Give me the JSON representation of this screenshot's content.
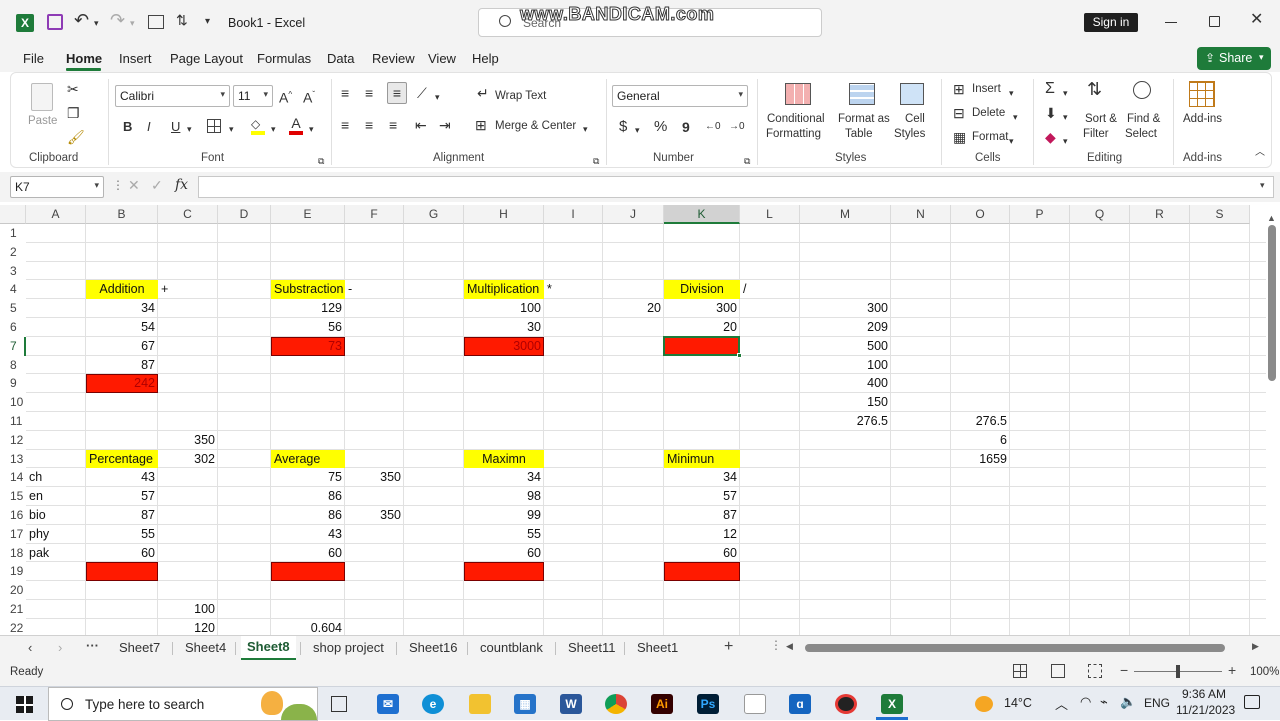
{
  "titlebar": {
    "title": "Book1  -  Excel",
    "search_placeholder": "Search",
    "watermark": "www.BANDICAM.com",
    "sign_in": "Sign in"
  },
  "menu": [
    "File",
    "Home",
    "Insert",
    "Page Layout",
    "Formulas",
    "Data",
    "Review",
    "View",
    "Help"
  ],
  "share": "Share",
  "ribbon": {
    "clipboard": {
      "paste": "Paste",
      "label": "Clipboard"
    },
    "font": {
      "name": "Calibri",
      "size": "11",
      "bold": "B",
      "italic": "I",
      "underline": "U",
      "label": "Font"
    },
    "alignment": {
      "wrap": "Wrap Text",
      "merge": "Merge & Center",
      "label": "Alignment"
    },
    "number": {
      "format": "General",
      "currency": "$",
      "percent": "%",
      "comma": "9",
      "label": "Number"
    },
    "styles": {
      "conditional_1": "Conditional",
      "conditional_2": "Formatting",
      "format_table_1": "Format as",
      "format_table_2": "Table",
      "cell_styles_1": "Cell",
      "cell_styles_2": "Styles",
      "label": "Styles"
    },
    "cells": {
      "insert": "Insert",
      "delete": "Delete",
      "format": "Format",
      "label": "Cells"
    },
    "editing": {
      "sort_1": "Sort &",
      "sort_2": "Filter",
      "find_1": "Find &",
      "find_2": "Select",
      "label": "Editing"
    },
    "addins": {
      "name": "Add-ins",
      "label": "Add-ins"
    }
  },
  "formula_bar": {
    "name_box": "K7",
    "fx": "fx",
    "value": ""
  },
  "columns": [
    "A",
    "B",
    "C",
    "D",
    "E",
    "F",
    "G",
    "H",
    "I",
    "J",
    "K",
    "L",
    "M",
    "N",
    "O",
    "P",
    "Q",
    "R",
    "S"
  ],
  "rows": [
    "1",
    "2",
    "3",
    "4",
    "5",
    "6",
    "7",
    "8",
    "9",
    "10",
    "11",
    "12",
    "13",
    "14",
    "15",
    "16",
    "17",
    "18",
    "19",
    "20",
    "21",
    "22"
  ],
  "cells": {
    "B4": "Addition",
    "C4": "+",
    "E4": "Substraction",
    "F4": "-",
    "H4": "Multiplication",
    "I4": "*",
    "K4": "Division",
    "L4": "/",
    "B5": "34",
    "E5": "129",
    "H5": "100",
    "J5": "20",
    "K5": "300",
    "M5": "300",
    "B6": "54",
    "E6": "56",
    "H6": "30",
    "K6": "20",
    "M6": "209",
    "B7": "67",
    "E7": "73",
    "H7": "3000",
    "M7": "500",
    "B8": "87",
    "M8": "100",
    "B9": "242",
    "M9": "400",
    "M10": "150",
    "M11": "276.5",
    "O11": "276.5",
    "C12": "350",
    "O12": "6",
    "B13": "Percentage",
    "C13": "302",
    "E13": "Average",
    "H13": "Maximn",
    "K13": "Minimun",
    "O13": "1659",
    "A14": "ch",
    "B14": "43",
    "E14": "75",
    "F14": "350",
    "H14": "34",
    "K14": "34",
    "A15": "en",
    "B15": "57",
    "E15": "86",
    "H15": "98",
    "K15": "57",
    "A16": "bio",
    "B16": "87",
    "E16": "86",
    "F16": "350",
    "H16": "99",
    "K16": "87",
    "A17": "phy",
    "B17": "55",
    "E17": "43",
    "H17": "55",
    "K17": "12",
    "A18": "pak",
    "B18": "60",
    "E18": "60",
    "H18": "60",
    "K18": "60",
    "C21": "100",
    "C22": "120",
    "E22": "0.604"
  },
  "sheet_tabs": [
    "Sheet7",
    "Sheet4",
    "Sheet8",
    "shop project",
    "Sheet16",
    "countblank",
    "Sheet11",
    "Sheet1"
  ],
  "active_tab": "Sheet8",
  "status": {
    "ready": "Ready",
    "zoom": "100%"
  },
  "taskbar": {
    "search": "Type here to search",
    "weather": "14°C",
    "lang": "ENG",
    "time": "9:36 AM",
    "date": "11/21/2023"
  },
  "colors": {
    "excel_green": "#217346",
    "highlight_yellow": "#ffff00",
    "highlight_red": "#ff1a00",
    "share_green": "#1e7b3a"
  }
}
